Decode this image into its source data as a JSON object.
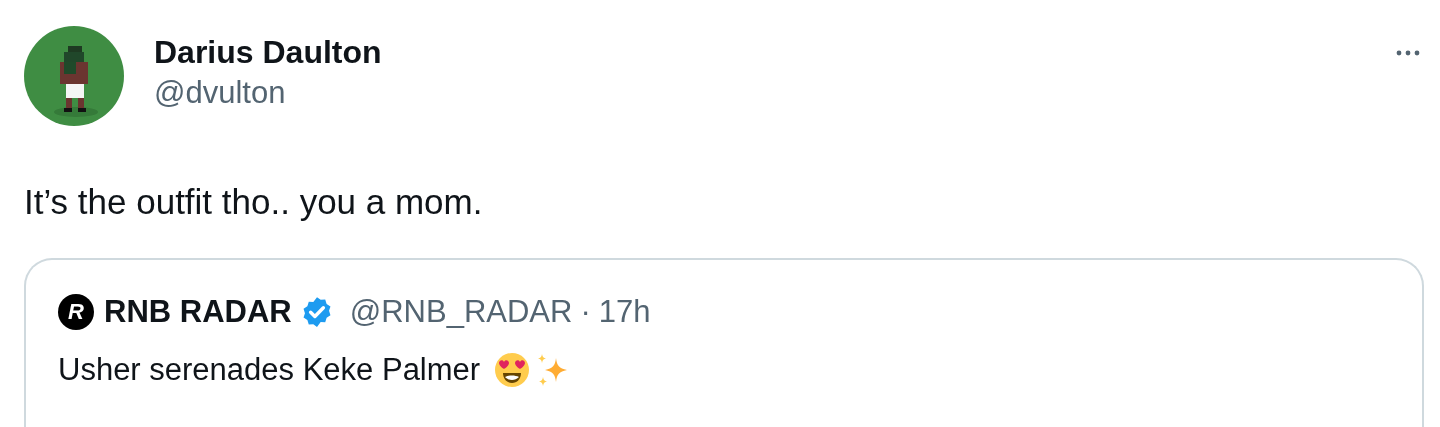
{
  "author": {
    "name": "Darius Daulton",
    "handle": "@dvulton"
  },
  "text": "It’s the outfit tho.. you a mom.",
  "quoted": {
    "logo_letter": "R",
    "name": "RNB RADAR",
    "verified": true,
    "handle": "@RNB_RADAR",
    "separator": "·",
    "time": "17h",
    "text": "Usher serenades Keke Palmer"
  }
}
